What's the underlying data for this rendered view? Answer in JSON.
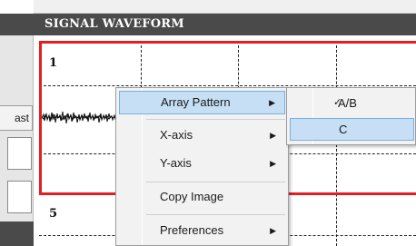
{
  "panel": {
    "title": "SIGNAL WAVEFORM"
  },
  "left_panel": {
    "button_label": "ast"
  },
  "charts": [
    {
      "label": "1"
    },
    {
      "label": "5"
    }
  ],
  "context_menu": {
    "items": [
      {
        "label": "Array Pattern",
        "has_submenu": true,
        "highlighted": true
      },
      {
        "label": "X-axis",
        "has_submenu": true
      },
      {
        "label": "Y-axis",
        "has_submenu": true
      },
      {
        "label": "Copy Image",
        "has_submenu": false
      },
      {
        "label": "Preferences",
        "has_submenu": true
      }
    ],
    "arrow_glyph": "▶"
  },
  "submenu": {
    "items": [
      {
        "label": "A/B",
        "checked": true,
        "check_glyph": "✓"
      },
      {
        "label": "C",
        "checked": false,
        "highlighted": true
      }
    ]
  },
  "colors": {
    "header_bg": "#4a4a4a",
    "selection_border": "#e31e24",
    "menu_highlight": "#c7dff5"
  }
}
